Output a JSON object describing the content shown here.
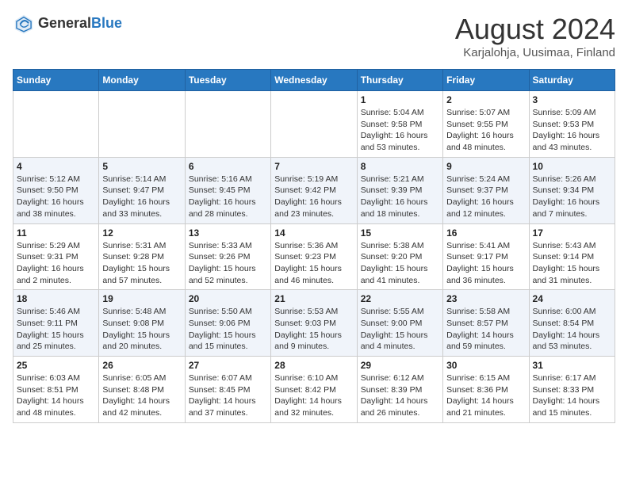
{
  "header": {
    "logo_general": "General",
    "logo_blue": "Blue",
    "month_title": "August 2024",
    "location": "Karjalohja, Uusimaa, Finland"
  },
  "days_of_week": [
    "Sunday",
    "Monday",
    "Tuesday",
    "Wednesday",
    "Thursday",
    "Friday",
    "Saturday"
  ],
  "weeks": [
    [
      {
        "day": "",
        "info": ""
      },
      {
        "day": "",
        "info": ""
      },
      {
        "day": "",
        "info": ""
      },
      {
        "day": "",
        "info": ""
      },
      {
        "day": "1",
        "info": "Sunrise: 5:04 AM\nSunset: 9:58 PM\nDaylight: 16 hours\nand 53 minutes."
      },
      {
        "day": "2",
        "info": "Sunrise: 5:07 AM\nSunset: 9:55 PM\nDaylight: 16 hours\nand 48 minutes."
      },
      {
        "day": "3",
        "info": "Sunrise: 5:09 AM\nSunset: 9:53 PM\nDaylight: 16 hours\nand 43 minutes."
      }
    ],
    [
      {
        "day": "4",
        "info": "Sunrise: 5:12 AM\nSunset: 9:50 PM\nDaylight: 16 hours\nand 38 minutes."
      },
      {
        "day": "5",
        "info": "Sunrise: 5:14 AM\nSunset: 9:47 PM\nDaylight: 16 hours\nand 33 minutes."
      },
      {
        "day": "6",
        "info": "Sunrise: 5:16 AM\nSunset: 9:45 PM\nDaylight: 16 hours\nand 28 minutes."
      },
      {
        "day": "7",
        "info": "Sunrise: 5:19 AM\nSunset: 9:42 PM\nDaylight: 16 hours\nand 23 minutes."
      },
      {
        "day": "8",
        "info": "Sunrise: 5:21 AM\nSunset: 9:39 PM\nDaylight: 16 hours\nand 18 minutes."
      },
      {
        "day": "9",
        "info": "Sunrise: 5:24 AM\nSunset: 9:37 PM\nDaylight: 16 hours\nand 12 minutes."
      },
      {
        "day": "10",
        "info": "Sunrise: 5:26 AM\nSunset: 9:34 PM\nDaylight: 16 hours\nand 7 minutes."
      }
    ],
    [
      {
        "day": "11",
        "info": "Sunrise: 5:29 AM\nSunset: 9:31 PM\nDaylight: 16 hours\nand 2 minutes."
      },
      {
        "day": "12",
        "info": "Sunrise: 5:31 AM\nSunset: 9:28 PM\nDaylight: 15 hours\nand 57 minutes."
      },
      {
        "day": "13",
        "info": "Sunrise: 5:33 AM\nSunset: 9:26 PM\nDaylight: 15 hours\nand 52 minutes."
      },
      {
        "day": "14",
        "info": "Sunrise: 5:36 AM\nSunset: 9:23 PM\nDaylight: 15 hours\nand 46 minutes."
      },
      {
        "day": "15",
        "info": "Sunrise: 5:38 AM\nSunset: 9:20 PM\nDaylight: 15 hours\nand 41 minutes."
      },
      {
        "day": "16",
        "info": "Sunrise: 5:41 AM\nSunset: 9:17 PM\nDaylight: 15 hours\nand 36 minutes."
      },
      {
        "day": "17",
        "info": "Sunrise: 5:43 AM\nSunset: 9:14 PM\nDaylight: 15 hours\nand 31 minutes."
      }
    ],
    [
      {
        "day": "18",
        "info": "Sunrise: 5:46 AM\nSunset: 9:11 PM\nDaylight: 15 hours\nand 25 minutes."
      },
      {
        "day": "19",
        "info": "Sunrise: 5:48 AM\nSunset: 9:08 PM\nDaylight: 15 hours\nand 20 minutes."
      },
      {
        "day": "20",
        "info": "Sunrise: 5:50 AM\nSunset: 9:06 PM\nDaylight: 15 hours\nand 15 minutes."
      },
      {
        "day": "21",
        "info": "Sunrise: 5:53 AM\nSunset: 9:03 PM\nDaylight: 15 hours\nand 9 minutes."
      },
      {
        "day": "22",
        "info": "Sunrise: 5:55 AM\nSunset: 9:00 PM\nDaylight: 15 hours\nand 4 minutes."
      },
      {
        "day": "23",
        "info": "Sunrise: 5:58 AM\nSunset: 8:57 PM\nDaylight: 14 hours\nand 59 minutes."
      },
      {
        "day": "24",
        "info": "Sunrise: 6:00 AM\nSunset: 8:54 PM\nDaylight: 14 hours\nand 53 minutes."
      }
    ],
    [
      {
        "day": "25",
        "info": "Sunrise: 6:03 AM\nSunset: 8:51 PM\nDaylight: 14 hours\nand 48 minutes."
      },
      {
        "day": "26",
        "info": "Sunrise: 6:05 AM\nSunset: 8:48 PM\nDaylight: 14 hours\nand 42 minutes."
      },
      {
        "day": "27",
        "info": "Sunrise: 6:07 AM\nSunset: 8:45 PM\nDaylight: 14 hours\nand 37 minutes."
      },
      {
        "day": "28",
        "info": "Sunrise: 6:10 AM\nSunset: 8:42 PM\nDaylight: 14 hours\nand 32 minutes."
      },
      {
        "day": "29",
        "info": "Sunrise: 6:12 AM\nSunset: 8:39 PM\nDaylight: 14 hours\nand 26 minutes."
      },
      {
        "day": "30",
        "info": "Sunrise: 6:15 AM\nSunset: 8:36 PM\nDaylight: 14 hours\nand 21 minutes."
      },
      {
        "day": "31",
        "info": "Sunrise: 6:17 AM\nSunset: 8:33 PM\nDaylight: 14 hours\nand 15 minutes."
      }
    ]
  ]
}
